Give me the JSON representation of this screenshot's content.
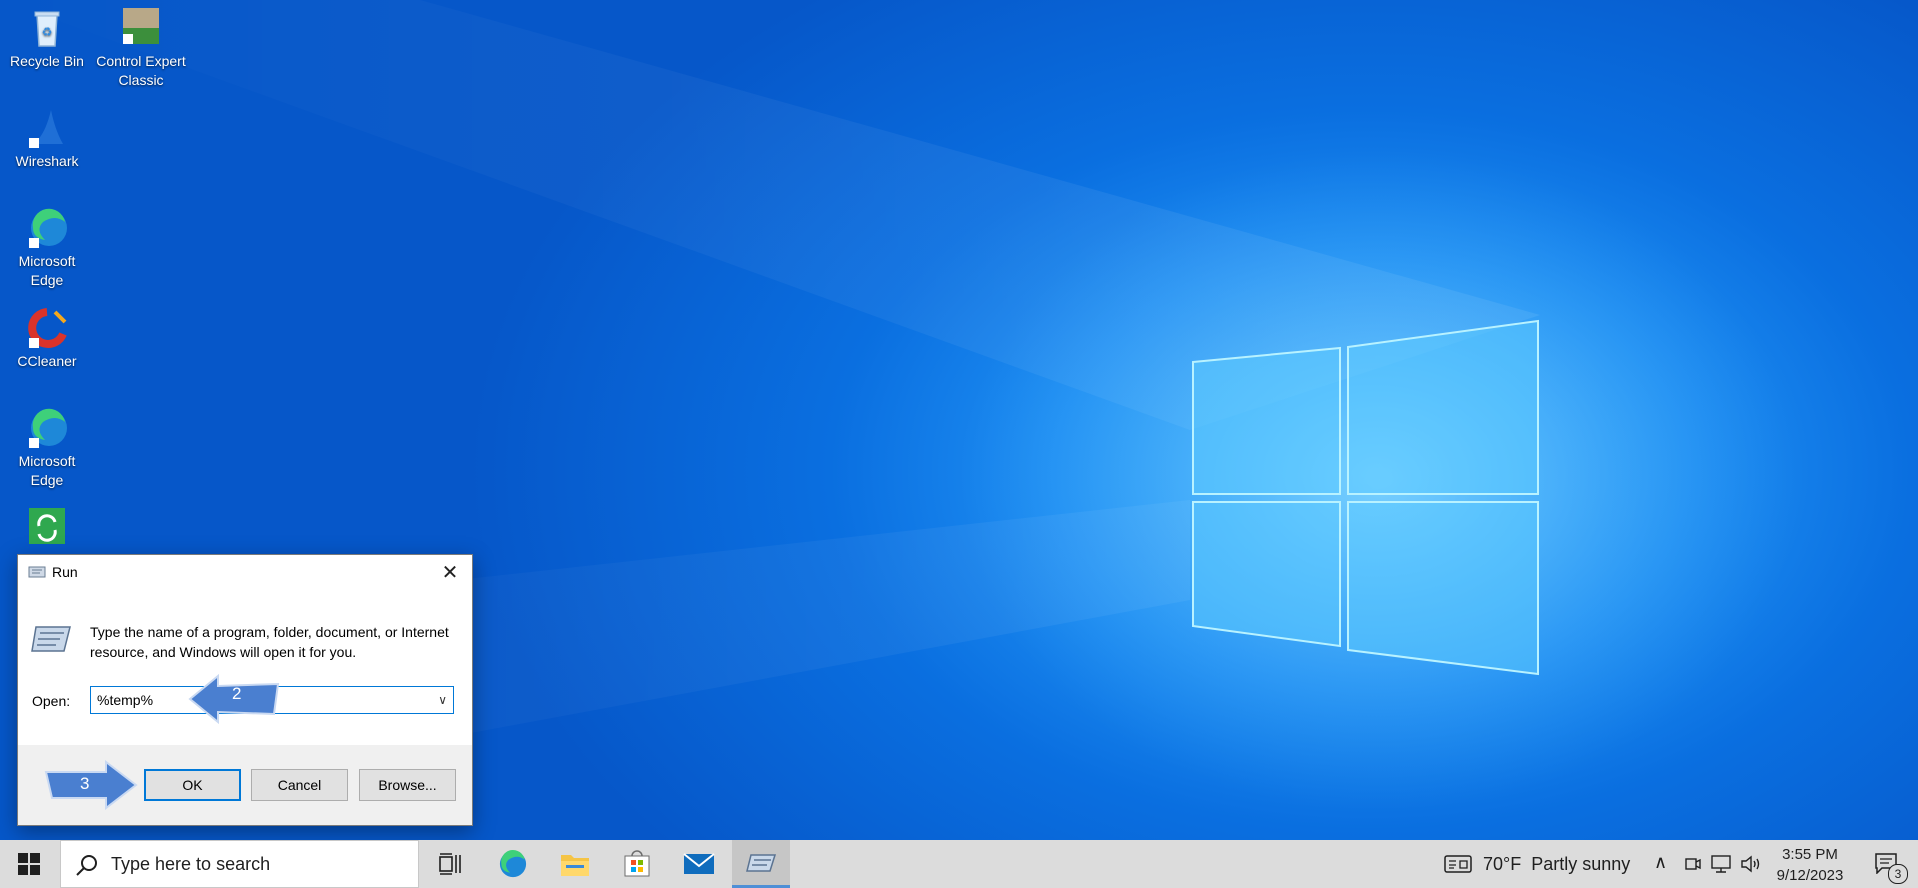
{
  "desktop": {
    "icons": [
      {
        "label": "Recycle Bin",
        "icon": "recycle-bin-icon"
      },
      {
        "label": "Control Expert Classic",
        "icon": "control-expert-icon"
      },
      {
        "label": "Wireshark",
        "icon": "wireshark-icon"
      },
      {
        "label": "Microsoft Edge",
        "icon": "edge-icon"
      },
      {
        "label": "CCleaner",
        "icon": "ccleaner-icon"
      },
      {
        "label": "Microsoft Edge",
        "icon": "edge-icon"
      },
      {
        "label": "",
        "icon": "software-update-icon"
      }
    ]
  },
  "run_dialog": {
    "title": "Run",
    "description": "Type the name of a program, folder, document, or Internet resource, and Windows will open it for you.",
    "open_label": "Open:",
    "open_value": "%temp%",
    "buttons": {
      "ok": "OK",
      "cancel": "Cancel",
      "browse": "Browse..."
    }
  },
  "annotations": {
    "step2": "2",
    "step3": "3",
    "color": "#4a7fd0"
  },
  "taskbar": {
    "search_placeholder": "Type here to search",
    "weather": "70°F  Partly sunny",
    "time": "3:55 PM",
    "date": "9/12/2023",
    "notification_count": "3"
  },
  "colors": {
    "accent": "#0078d7",
    "taskbar": "#dcdcdc"
  }
}
